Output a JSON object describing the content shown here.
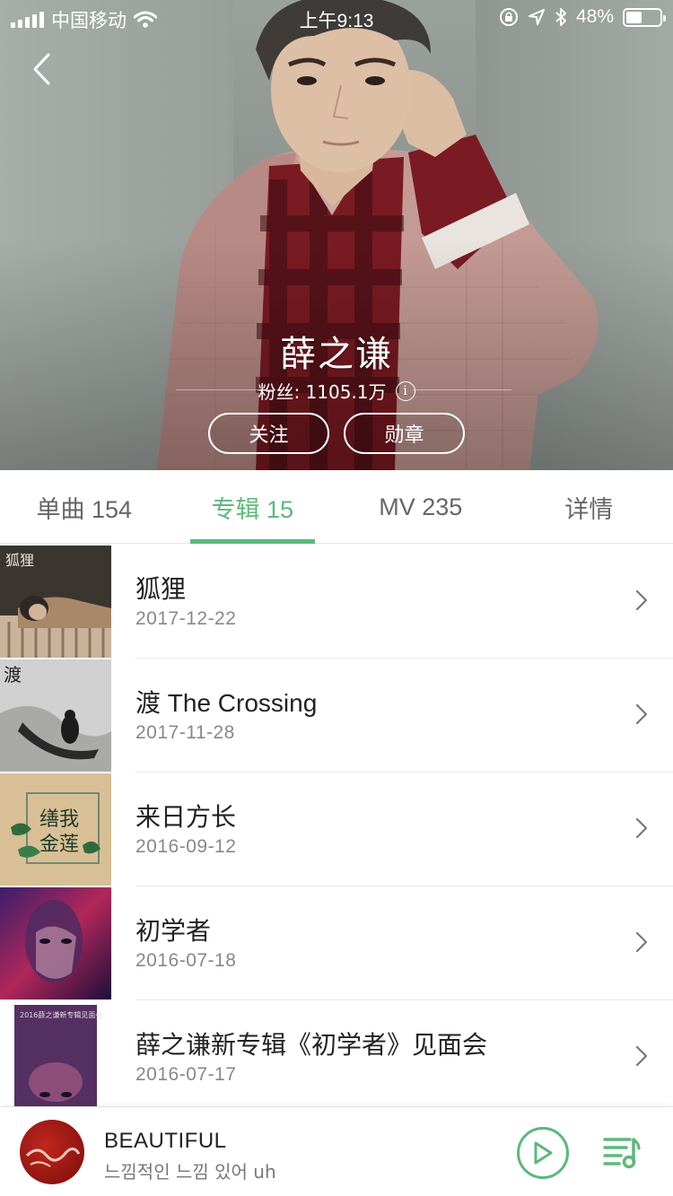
{
  "status_bar": {
    "carrier": "中国移动",
    "time": "上午9:13",
    "battery_percent": "48%",
    "battery_level": 0.48
  },
  "artist": {
    "name": "薛之谦",
    "fans_label": "粉丝: 1105.1万",
    "follow_label": "关注",
    "medal_label": "勋章"
  },
  "tabs": [
    {
      "label": "单曲 154",
      "active": false
    },
    {
      "label": "专辑 15",
      "active": true
    },
    {
      "label": "MV 235",
      "active": false
    },
    {
      "label": "详情",
      "active": false
    }
  ],
  "albums": [
    {
      "title": "狐狸",
      "date": "2017-12-22",
      "cover_text": "狐狸"
    },
    {
      "title": "渡 The Crossing",
      "date": "2017-11-28",
      "cover_text": "渡"
    },
    {
      "title": "来日方长",
      "date": "2016-09-12",
      "cover_text": "我\n缮\n金\n莲"
    },
    {
      "title": "初学者",
      "date": "2016-07-18",
      "cover_text": ""
    },
    {
      "title": "薛之谦新专辑《初学者》见面会",
      "date": "2016-07-17",
      "cover_text": "2016薛之谦新专辑见面会"
    }
  ],
  "now_playing": {
    "title": "BEAUTIFUL",
    "subtitle": "느낌적인 느낌 있어 uh"
  },
  "colors": {
    "accent": "#5cb97a",
    "text_primary": "#222222",
    "text_secondary": "#888888"
  }
}
